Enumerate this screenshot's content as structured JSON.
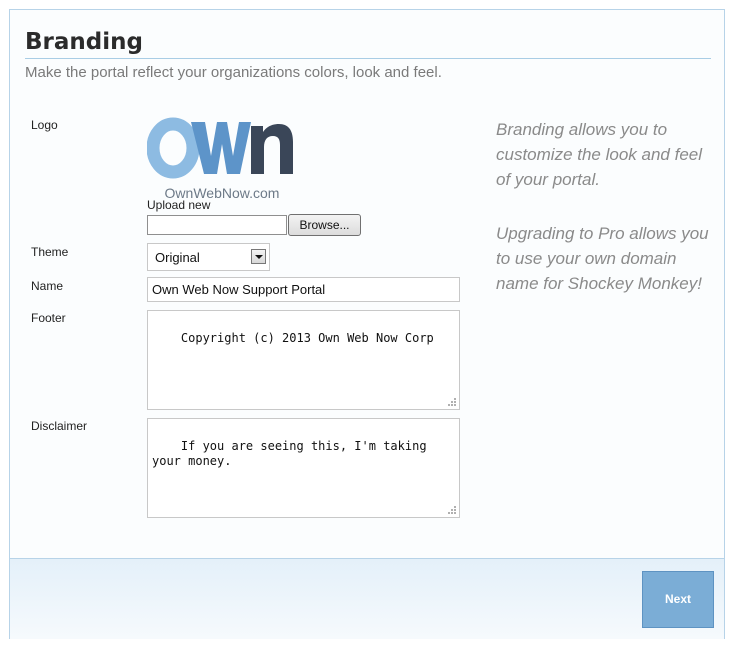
{
  "header": {
    "title": "Branding",
    "subtitle": "Make the portal reflect your organizations colors, look and feel."
  },
  "form": {
    "logo_label": "Logo",
    "logo_text": "OwnWebNow.com",
    "upload_label": "Upload new",
    "file_value": "",
    "browse_label": "Browse...",
    "theme_label": "Theme",
    "theme_value": "Original",
    "name_label": "Name",
    "name_value": "Own Web Now Support Portal",
    "footer_label": "Footer",
    "footer_value": "Copyright (c) 2013 Own Web Now Corp",
    "disclaimer_label": "Disclaimer",
    "disclaimer_value": "If you are seeing this, I'm taking\nyour money."
  },
  "help": {
    "paragraph1": "Branding allows you to customize the look and feel of your portal.",
    "paragraph2": "Upgrading to Pro allows you to use your own domain name for Shockey Monkey!"
  },
  "actions": {
    "next_label": "Next"
  },
  "colors": {
    "accent": "#7badd6",
    "logo_light_blue": "#8dbbe2",
    "logo_mid_blue": "#5d94c9",
    "logo_dark": "#3a4658"
  }
}
